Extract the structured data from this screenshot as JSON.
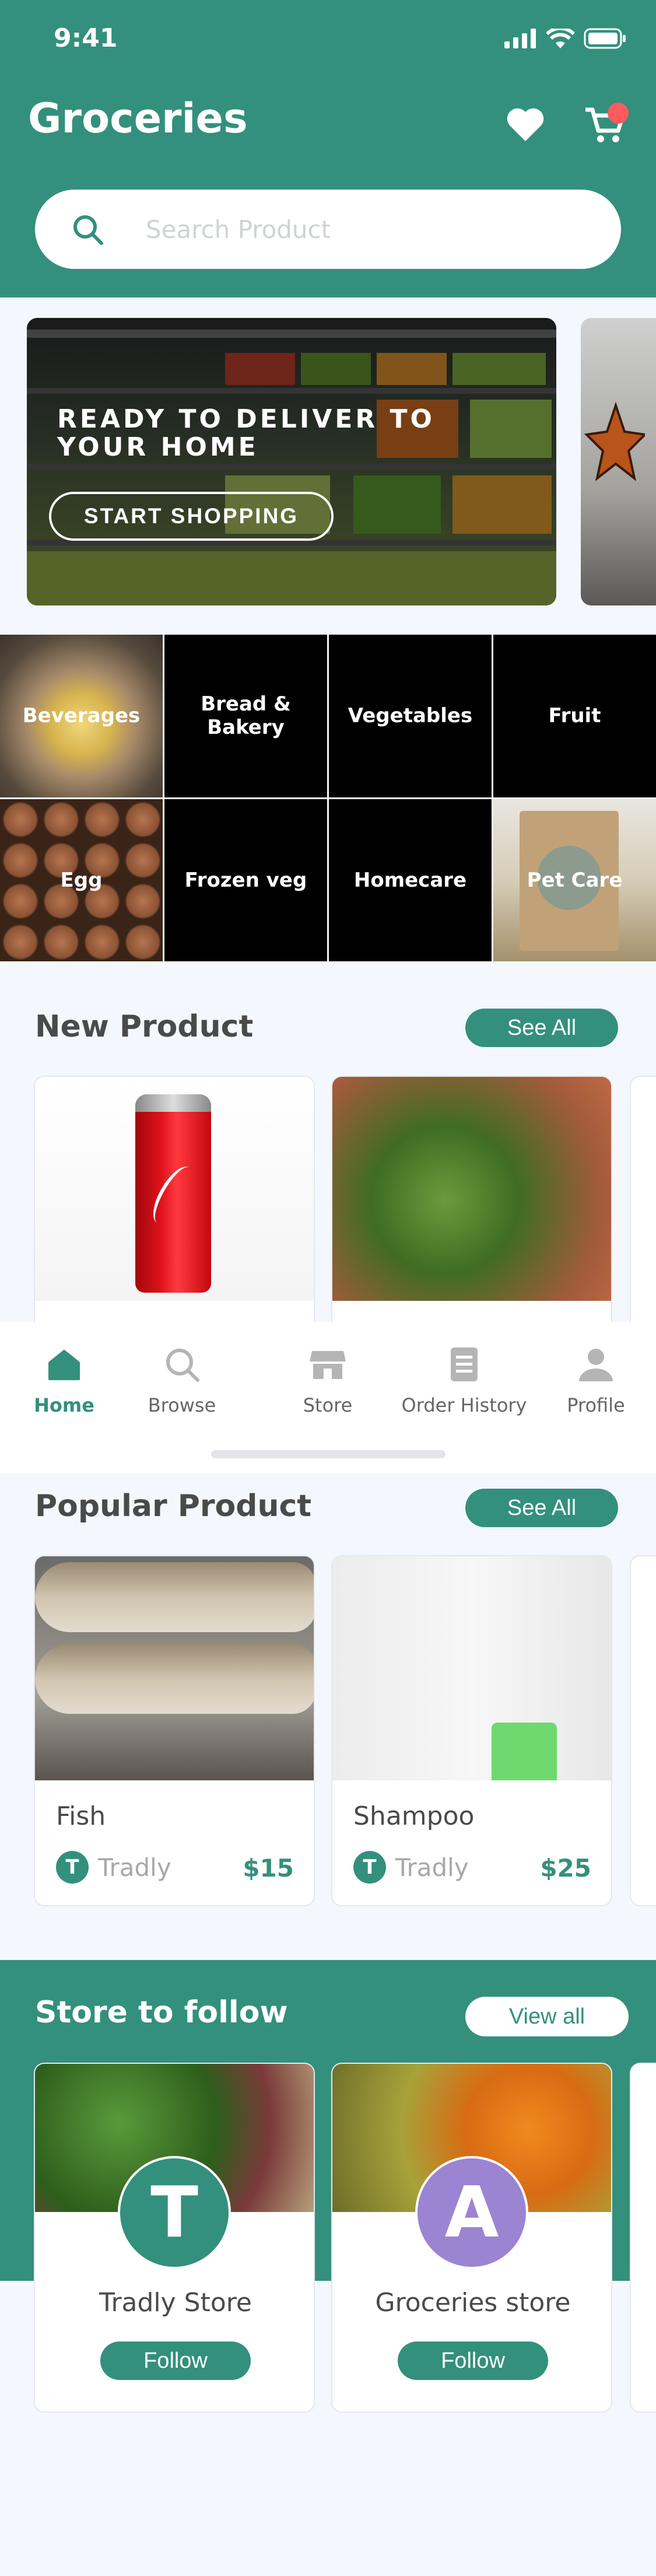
{
  "status_bar": {
    "time": "9:41"
  },
  "header": {
    "title": "Groceries",
    "search_placeholder": "Search Product",
    "icons": [
      "heart-icon",
      "cart-icon"
    ]
  },
  "banner": {
    "title_line1": "READY TO DELIVER TO",
    "title_line2": "YOUR HOME",
    "button_label": "START SHOPPING"
  },
  "categories": [
    {
      "label": "Beverages"
    },
    {
      "label": "Bread & Bakery"
    },
    {
      "label": "Vegetables"
    },
    {
      "label": "Fruit"
    },
    {
      "label": "Egg"
    },
    {
      "label": "Frozen veg"
    },
    {
      "label": "Homecare"
    },
    {
      "label": "Pet Care"
    }
  ],
  "new_product": {
    "title": "New Product",
    "see_all": "See All"
  },
  "bottom_nav": {
    "items": [
      {
        "label": "Home",
        "icon": "home-icon",
        "active": true
      },
      {
        "label": "Browse",
        "icon": "search-icon",
        "active": false
      },
      {
        "label": "Store",
        "icon": "store-icon",
        "active": false
      },
      {
        "label": "Order History",
        "icon": "order-history-icon",
        "active": false
      },
      {
        "label": "Profile",
        "icon": "profile-icon",
        "active": false
      }
    ]
  },
  "popular_product": {
    "title": "Popular Product",
    "see_all": "See All",
    "items": [
      {
        "name": "Fish",
        "seller_initial": "T",
        "seller": "Tradly",
        "price": "$15"
      },
      {
        "name": "Shampoo",
        "seller_initial": "T",
        "seller": "Tradly",
        "price": "$25"
      }
    ]
  },
  "stores": {
    "title": "Store to follow",
    "view_all": "View all",
    "items": [
      {
        "initial": "T",
        "name": "Tradly Store",
        "follow": "Follow",
        "avatar_color": "#33907c"
      },
      {
        "initial": "A",
        "name": "Groceries store",
        "follow": "Follow",
        "avatar_color": "#9b84d1"
      }
    ]
  },
  "colors": {
    "primary": "#33907c",
    "background": "#f4f7fd",
    "cart_badge": "#ff5a5f"
  }
}
